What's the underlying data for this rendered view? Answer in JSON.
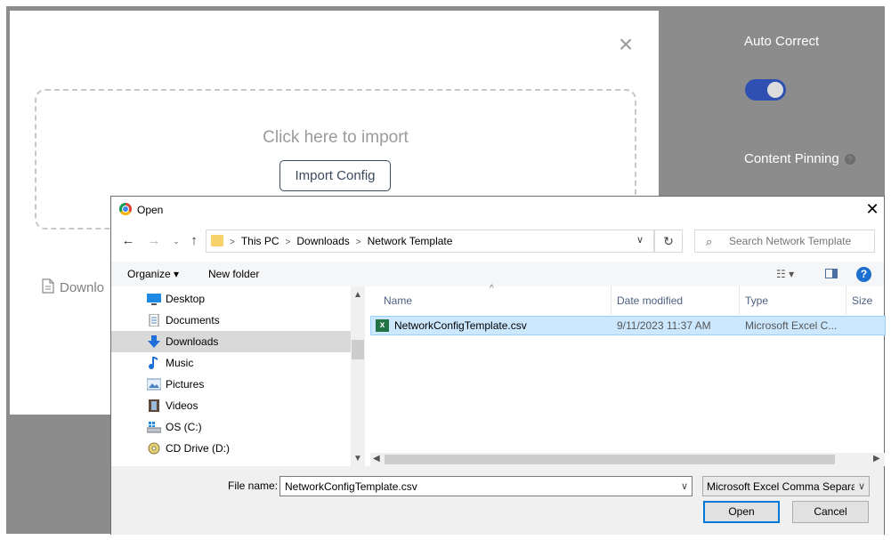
{
  "import_modal": {
    "close_icon": "close-icon",
    "drop_title": "Click here to import",
    "import_button": "Import Config",
    "download_label": "Downlo"
  },
  "settings": {
    "auto_correct": "Auto Correct",
    "auto_correct_enabled": true,
    "content_pinning": "Content Pinning",
    "help_glyph": "?"
  },
  "dialog": {
    "title": "Open",
    "address": {
      "crumbs": [
        "This PC",
        "Downloads",
        "Network Template"
      ]
    },
    "search_placeholder": "Search Network Template",
    "toolbar": {
      "organize": "Organize ▾",
      "new_folder": "New folder"
    },
    "nav_items": [
      {
        "label": "Desktop",
        "icon": "desktop-icon"
      },
      {
        "label": "Documents",
        "icon": "documents-icon"
      },
      {
        "label": "Downloads",
        "icon": "downloads-icon",
        "selected": true
      },
      {
        "label": "Music",
        "icon": "music-icon"
      },
      {
        "label": "Pictures",
        "icon": "pictures-icon"
      },
      {
        "label": "Videos",
        "icon": "videos-icon"
      },
      {
        "label": "OS (C:)",
        "icon": "drive-icon"
      },
      {
        "label": "CD Drive (D:)",
        "icon": "cd-drive-icon"
      }
    ],
    "columns": [
      "Name",
      "Date modified",
      "Type",
      "Size"
    ],
    "files": [
      {
        "name": "NetworkConfigTemplate.csv",
        "date": "9/11/2023 11:37 AM",
        "type": "Microsoft Excel C...",
        "size": ""
      }
    ],
    "file_name_label": "File name:",
    "file_name_value": "NetworkConfigTemplate.csv",
    "file_type": "Microsoft Excel Comma Separated",
    "open_button": "Open",
    "cancel_button": "Cancel"
  },
  "colors": {
    "accent": "#0078d7",
    "toggle_on": "#2f4fb3",
    "selection": "#cce8ff"
  }
}
